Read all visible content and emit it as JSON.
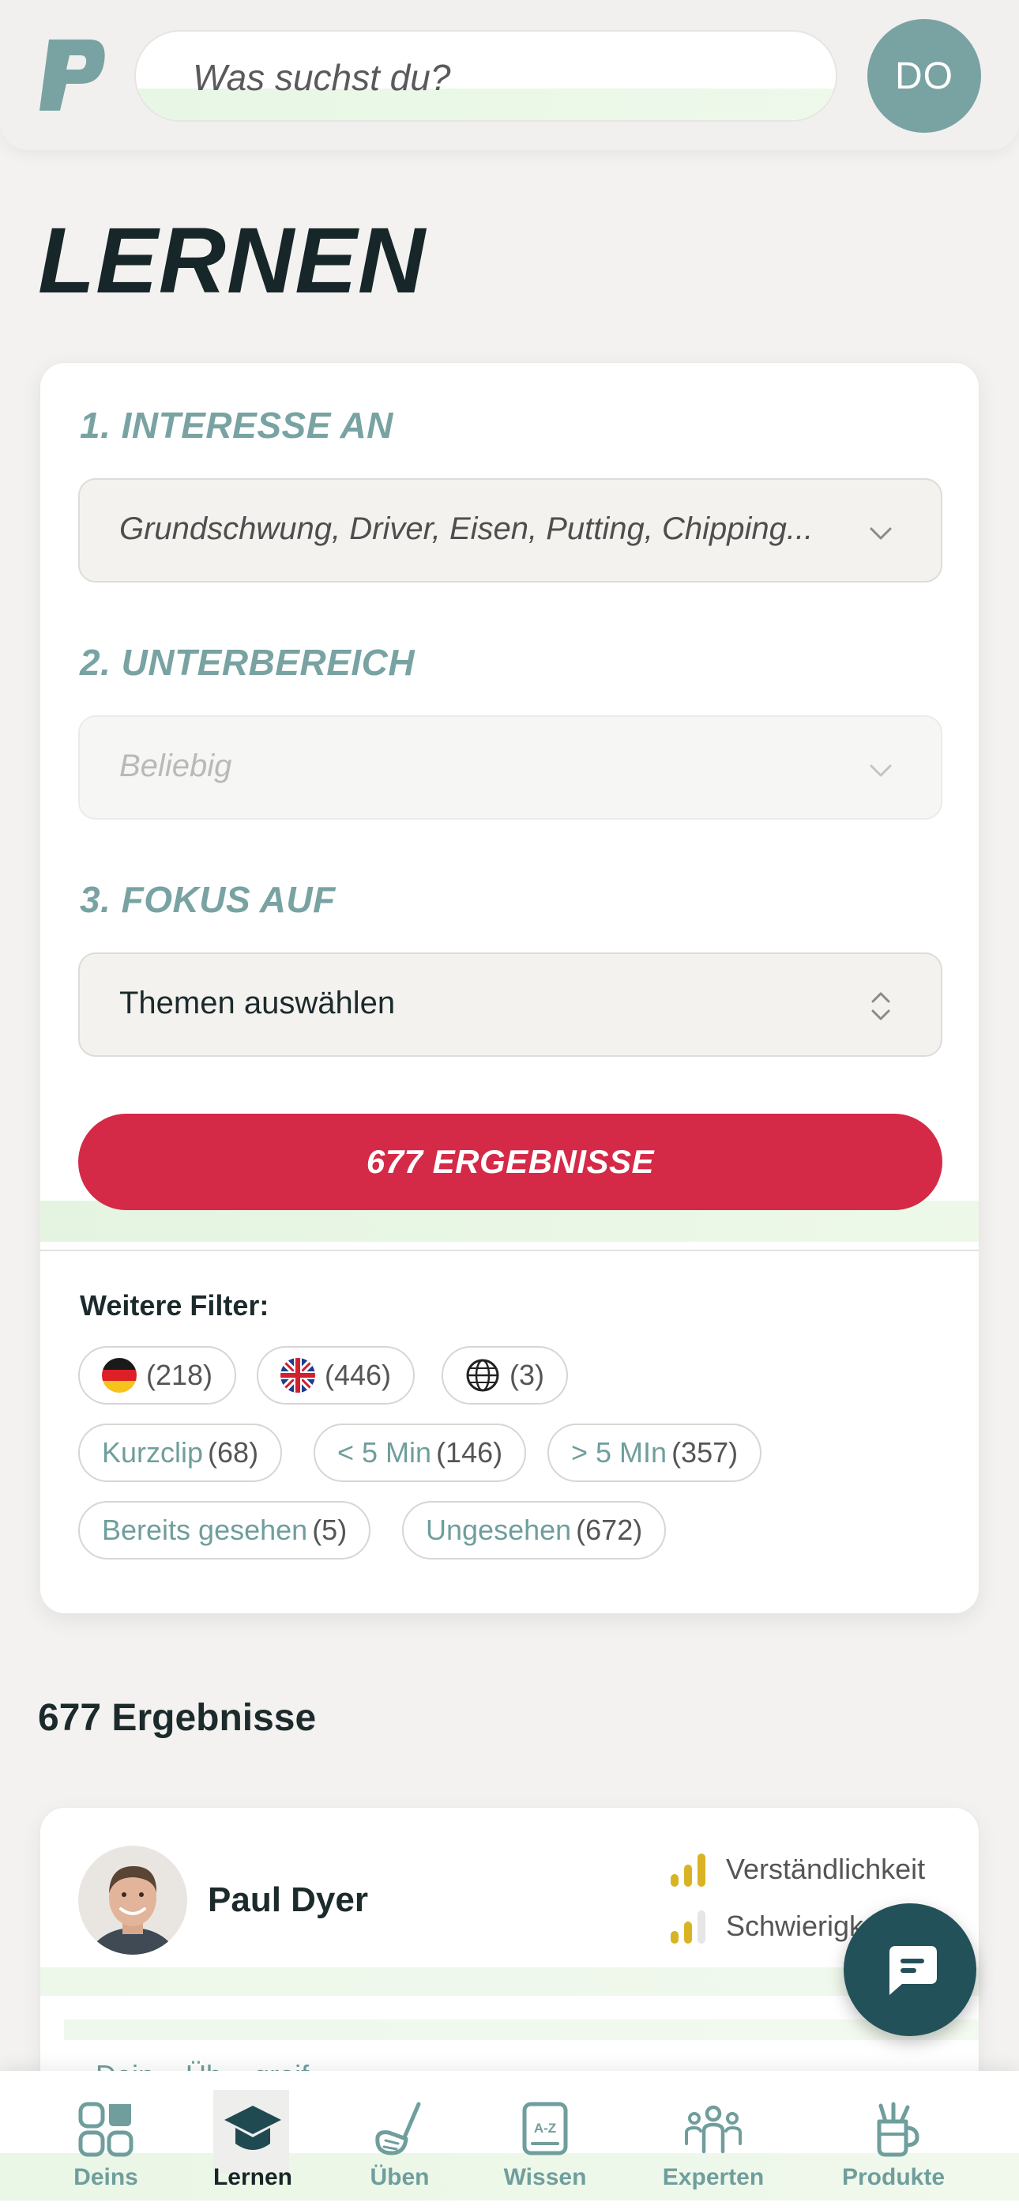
{
  "header": {
    "logo_letter": "P",
    "search_placeholder": "Was suchst du?",
    "avatar_initials": "DO"
  },
  "page_title": "LERNEN",
  "filters": {
    "interest": {
      "label": "1. INTERESSE AN",
      "value": "Grundschwung, Driver, Eisen, Putting, Chipping..."
    },
    "subarea": {
      "label": "2. UNTERBEREICH",
      "value": "Beliebig"
    },
    "focus": {
      "label": "3. FOKUS AUF",
      "value": "Themen auswählen"
    },
    "results_button": "677 ERGEBNISSE",
    "more_filters_label": "Weitere Filter:",
    "chips": {
      "german": {
        "count": "(218)"
      },
      "english": {
        "count": "(446)"
      },
      "international": {
        "count": "(3)"
      },
      "kurzclip": {
        "label": "Kurzclip",
        "count": "(68)"
      },
      "under5": {
        "label": "< 5 Min",
        "count": "(146)"
      },
      "over5": {
        "label": "> 5 MIn",
        "count": "(357)"
      },
      "seen": {
        "label": "Bereits gesehen",
        "count": "(5)"
      },
      "unseen": {
        "label": "Ungesehen",
        "count": "(672)"
      }
    }
  },
  "results": {
    "count_label": "677 Ergebnisse",
    "card": {
      "trainer_name": "Paul Dyer",
      "metric_1": "Verständlichkeit",
      "metric_2": "Schwierigk",
      "subtitle": "Dein... Üb... greif... ..."
    }
  },
  "bottom_nav": {
    "deins": "Deins",
    "lernen": "Lernen",
    "ueben": "Üben",
    "wissen": "Wissen",
    "experten": "Experten",
    "produkte": "Produkte"
  },
  "colors": {
    "accent_teal": "#78a3a2",
    "dark_teal": "#235159",
    "primary_red": "#d42a47",
    "metric_gold": "#d9b324"
  }
}
